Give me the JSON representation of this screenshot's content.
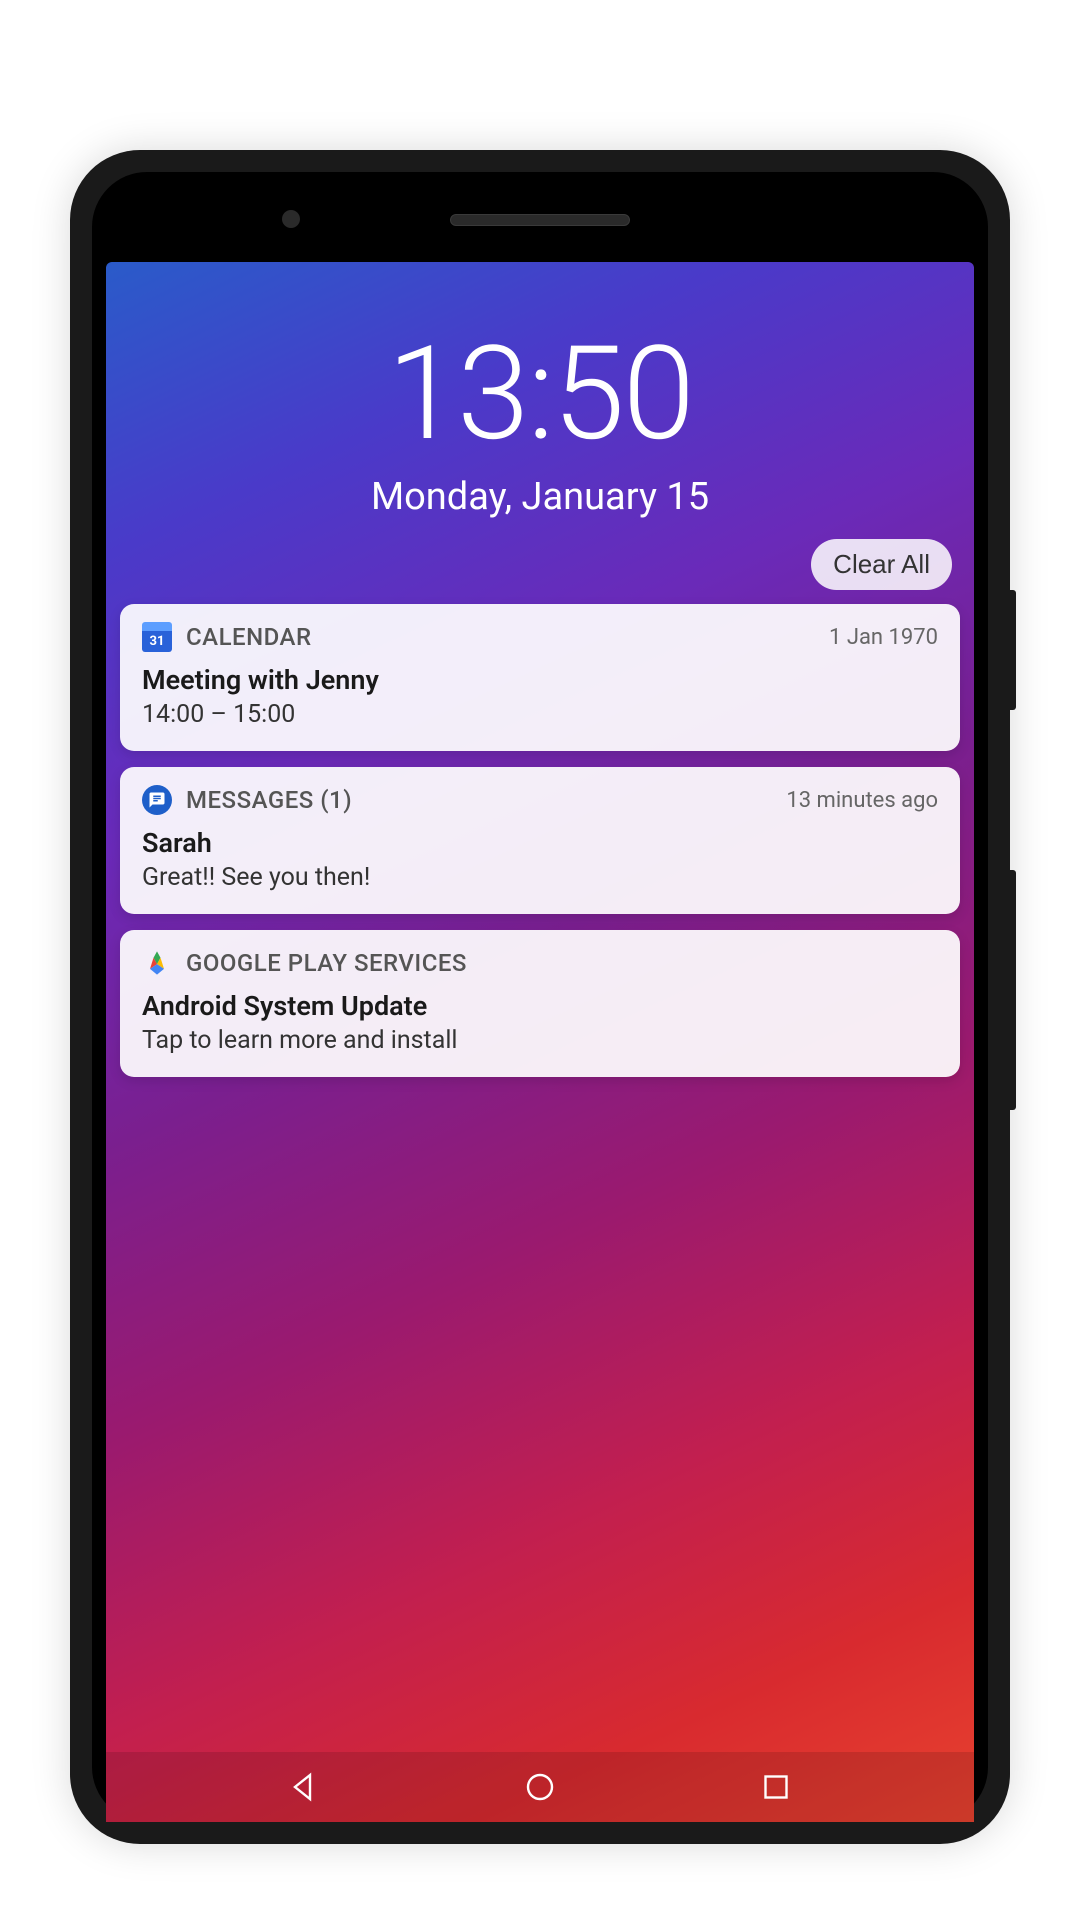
{
  "lock_screen": {
    "time": "13:50",
    "date": "Monday, January 15",
    "clear_all_label": "Clear All"
  },
  "calendar_icon_day": "31",
  "notifications": [
    {
      "app_name": "CALENDAR",
      "timestamp": "1 Jan 1970",
      "title": "Meeting with Jenny",
      "body": "14:00 – 15:00"
    },
    {
      "app_name": "MESSAGES (1)",
      "timestamp": "13 minutes ago",
      "title": "Sarah",
      "body": "Great!! See you then!"
    },
    {
      "app_name": "GOOGLE PLAY SERVICES",
      "timestamp": "",
      "title": "Android System Update",
      "body": "Tap to learn more and install"
    }
  ]
}
